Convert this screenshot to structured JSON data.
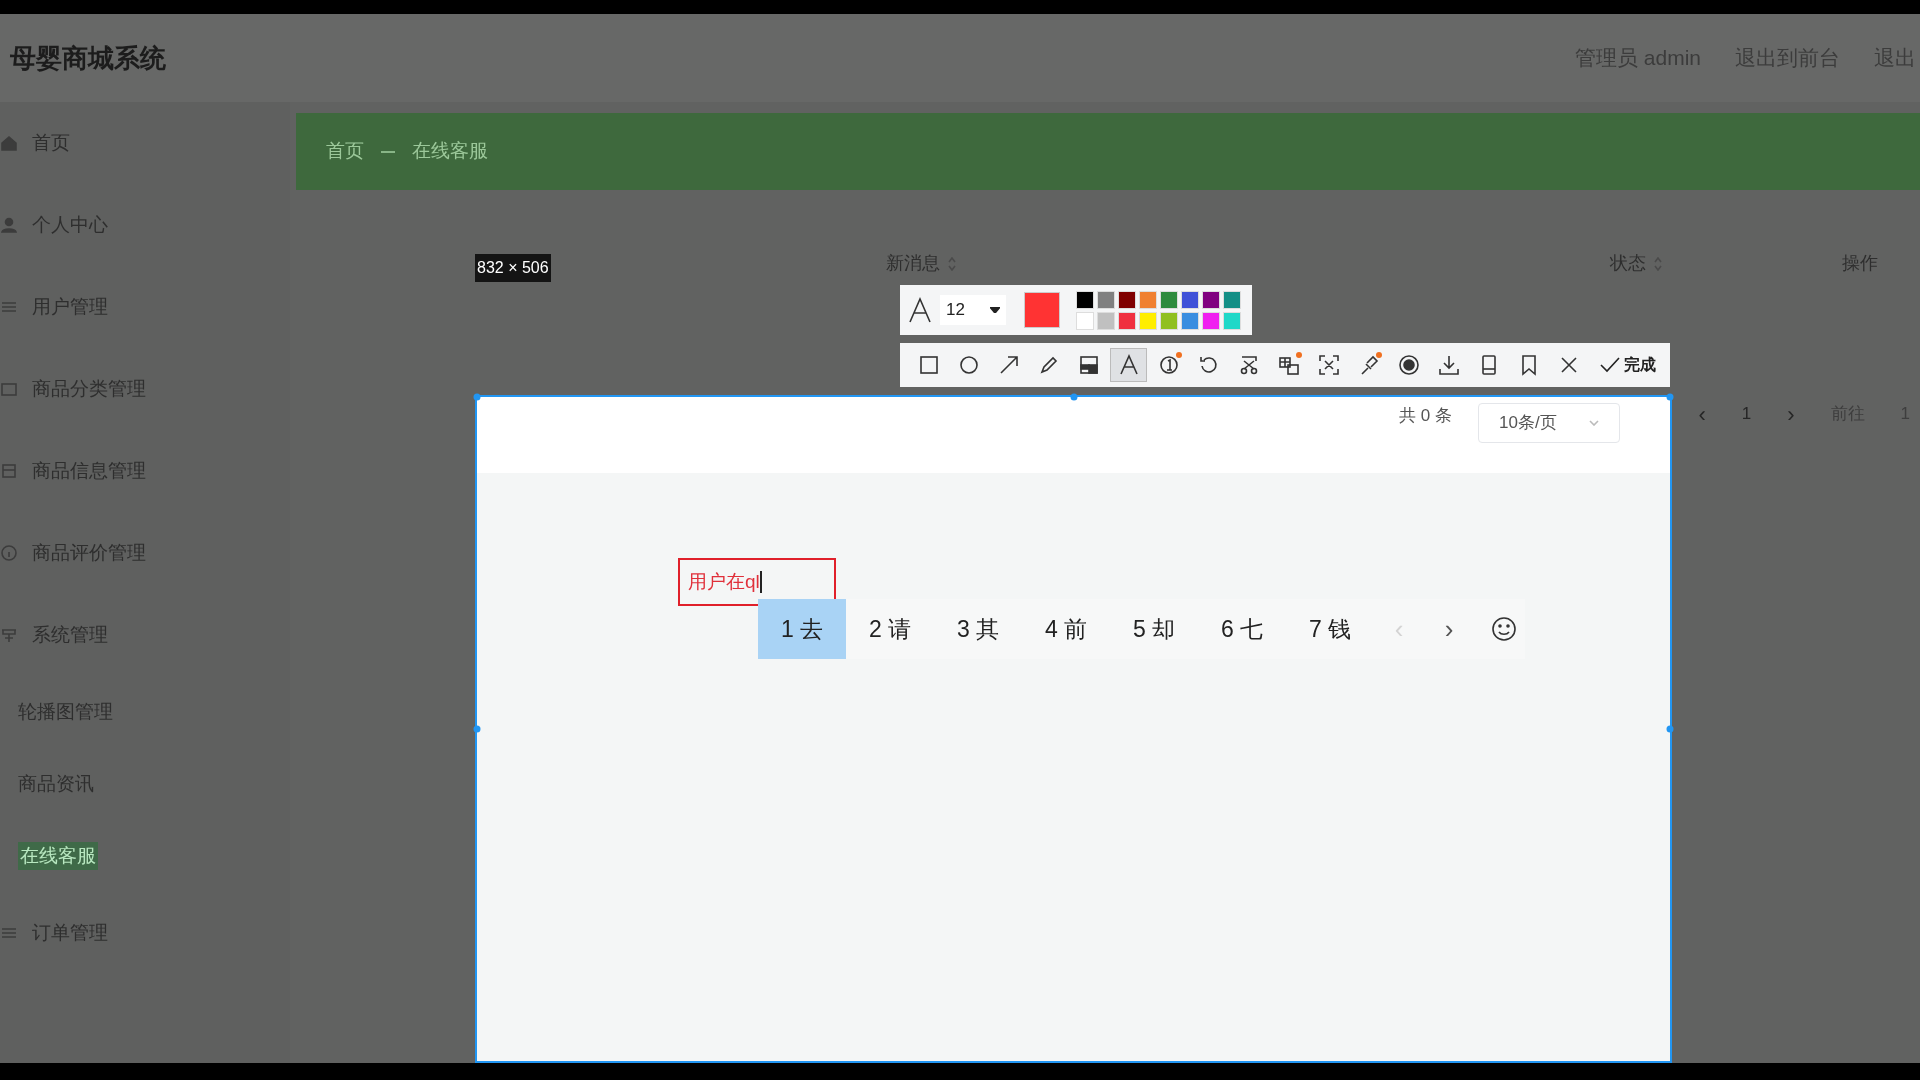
{
  "app": {
    "title": "母婴商城系统",
    "header_links": [
      "管理员 admin",
      "退出到前台",
      "退出"
    ]
  },
  "sidebar": {
    "items": [
      {
        "label": "首页",
        "selected": false
      },
      {
        "label": "个人中心",
        "selected": false
      },
      {
        "label": "用户管理",
        "selected": false
      },
      {
        "label": "商品分类管理",
        "selected": false
      },
      {
        "label": "商品信息管理",
        "selected": false
      },
      {
        "label": "商品评价管理",
        "selected": false
      },
      {
        "label": "系统管理",
        "selected": false,
        "children": [
          {
            "label": "轮播图管理",
            "selected": false
          },
          {
            "label": "商品资讯",
            "selected": false
          },
          {
            "label": "在线客服",
            "selected": true
          }
        ]
      },
      {
        "label": "订单管理",
        "selected": false
      }
    ]
  },
  "breadcrumb": [
    "首页",
    "在线客服"
  ],
  "table": {
    "columns": [
      {
        "label": "新消息",
        "sortable": true
      },
      {
        "label": "状态",
        "sortable": true
      },
      {
        "label": "操作",
        "sortable": false
      }
    ]
  },
  "pagination": {
    "total": "共 0 条",
    "page_size": "10条/页",
    "prev": "‹",
    "current": "1",
    "next": "›",
    "goto_label": "前往",
    "goto_value": "1"
  },
  "capture": {
    "size_label": "832 × 506",
    "font_size": "12",
    "palette": [
      {
        "color": "#000000"
      },
      {
        "color": "#808080"
      },
      {
        "color": "#800000"
      },
      {
        "color": "#f08030"
      },
      {
        "color": "#2e8b3e"
      },
      {
        "color": "#3f51d8"
      },
      {
        "color": "#800080"
      },
      {
        "color": "#138f86"
      },
      {
        "color": "#ffffff"
      },
      {
        "color": "#c0c0c0"
      },
      {
        "color": "#f03040"
      },
      {
        "color": "#ffee00"
      },
      {
        "color": "#90c020"
      },
      {
        "color": "#3a8ee0"
      },
      {
        "color": "#f020f0"
      },
      {
        "color": "#20d8c8"
      }
    ],
    "tools": [
      {
        "kind": "rect",
        "selected": false,
        "dot": false
      },
      {
        "kind": "ellipse",
        "selected": false,
        "dot": false
      },
      {
        "kind": "arrow",
        "selected": false,
        "dot": false
      },
      {
        "kind": "pencil",
        "selected": false,
        "dot": false
      },
      {
        "kind": "mosaic",
        "selected": false,
        "dot": false
      },
      {
        "kind": "text",
        "selected": true,
        "dot": false
      },
      {
        "kind": "number",
        "selected": false,
        "dot": true
      },
      {
        "kind": "undo",
        "selected": false,
        "dot": false
      },
      {
        "kind": "scissors",
        "selected": false,
        "dot": false
      },
      {
        "kind": "translate",
        "selected": false,
        "dot": true
      },
      {
        "kind": "scan",
        "selected": false,
        "dot": false
      },
      {
        "kind": "pin",
        "selected": false,
        "dot": true
      },
      {
        "kind": "record",
        "selected": false,
        "dot": false
      },
      {
        "kind": "download",
        "selected": false,
        "dot": false
      },
      {
        "kind": "device",
        "selected": false,
        "dot": false
      },
      {
        "kind": "bookmark",
        "selected": false,
        "dot": false
      },
      {
        "kind": "close",
        "selected": false,
        "dot": false
      }
    ],
    "done_label": "完成",
    "text_box": {
      "value": "用户在ql"
    },
    "ime": {
      "candidates": [
        {
          "label": "1 去",
          "selected": true
        },
        {
          "label": "2 请",
          "selected": false
        },
        {
          "label": "3 其",
          "selected": false
        },
        {
          "label": "4 前",
          "selected": false
        },
        {
          "label": "5 却",
          "selected": false
        },
        {
          "label": "6 七",
          "selected": false
        },
        {
          "label": "7 钱",
          "selected": false
        }
      ],
      "prev": {
        "label": "‹",
        "disabled": true
      },
      "next": {
        "label": "›",
        "disabled": false
      }
    }
  }
}
